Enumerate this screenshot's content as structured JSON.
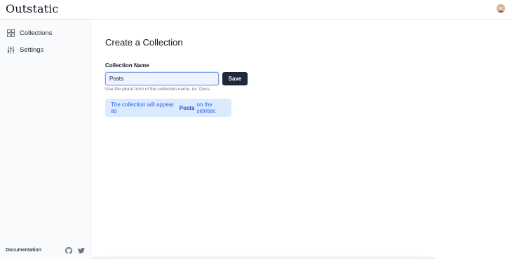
{
  "app": {
    "logo": "Outstatic"
  },
  "header": {
    "avatar_icon": "user-avatar"
  },
  "sidebar": {
    "items": [
      {
        "label": "Collections",
        "icon": "grid-icon"
      },
      {
        "label": "Settings",
        "icon": "sliders-icon"
      }
    ],
    "footer": {
      "documentation_label": "Documentation",
      "icons": [
        "github-icon",
        "twitter-icon"
      ]
    }
  },
  "main": {
    "title": "Create a Collection",
    "field_label": "Collection Name",
    "input_value": "Posts",
    "save_label": "Save",
    "hint": "Use the plural form of the collection name, ex: Docs",
    "info": {
      "prefix": "The collection will appear as",
      "highlight": "Posts",
      "suffix": "on the sidebar."
    }
  },
  "colors": {
    "accent": "#2563eb",
    "button_bg": "#1f2937",
    "info_bg": "#dbeafe",
    "sidebar_bg": "#f9fafb"
  }
}
